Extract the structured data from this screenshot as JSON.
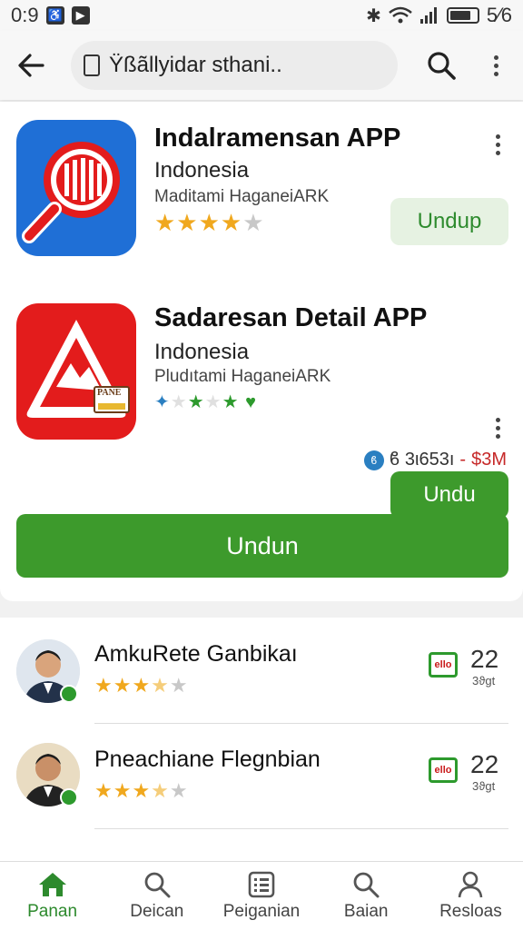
{
  "status_bar": {
    "time": "0:9",
    "battery_text": "5⁄6"
  },
  "search": {
    "query": "Ÿßãllyidar sthani.."
  },
  "apps": [
    {
      "title": "Indalramensan APP",
      "country": "Indonesia",
      "developer": "Maditami HaganeiARK",
      "rating": 4,
      "button": "Undup"
    },
    {
      "title": "Sadaresan Detail APP",
      "country": "Indonesia",
      "developer": "Pludıtami HaganeiARK",
      "rating": 3,
      "button": "Undu",
      "icon_badge": "PANE"
    }
  ],
  "price": {
    "value": "ϐ 3ι653ı",
    "separator": "-",
    "amount": "$3M"
  },
  "main_button": "Undun",
  "reviews": [
    {
      "name": "AmkuRete Ganbikaı",
      "rating": 3.5,
      "badge": "ello",
      "count": "22",
      "sub": "3ϑgt"
    },
    {
      "name": "Pneachiane Flegnbian",
      "rating": 3.5,
      "badge": "ello",
      "count": "22",
      "sub": "3ϑgt"
    }
  ],
  "nav": [
    {
      "label": "Panan",
      "icon": "home-icon"
    },
    {
      "label": "Deican",
      "icon": "search-icon"
    },
    {
      "label": "Peiganian",
      "icon": "list-icon"
    },
    {
      "label": "Baian",
      "icon": "search-icon"
    },
    {
      "label": "Resloas",
      "icon": "person-icon"
    }
  ],
  "colors": {
    "accent_green": "#3d9a2c",
    "star": "#f0a81e",
    "icon_blue": "#1f6fd6",
    "icon_red": "#e31c1c"
  }
}
